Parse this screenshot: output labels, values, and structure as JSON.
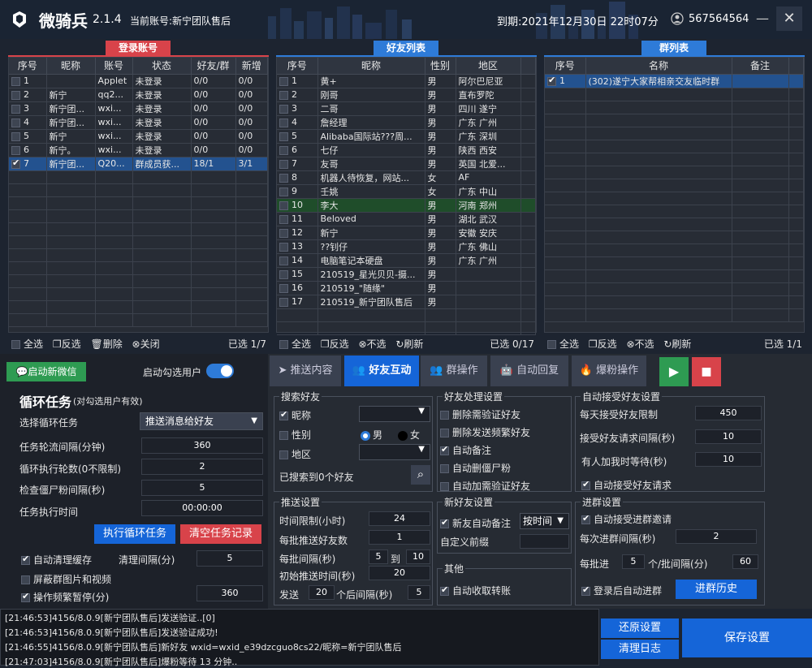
{
  "header": {
    "app_name": "微骑兵",
    "version": "2.1.4",
    "current_account": "当前账号:新宁团队售后",
    "expire": "到期:2021年12月30日 22时07分",
    "user_id": "567564564"
  },
  "accounts": {
    "title": "登录账号",
    "columns": [
      "序号",
      "昵称",
      "账号",
      "状态",
      "好友/群",
      "新增"
    ],
    "rows": [
      {
        "checked": false,
        "sel": false,
        "c": [
          "1",
          "",
          "Applet",
          "未登录",
          "0/0",
          "0/0"
        ]
      },
      {
        "checked": false,
        "sel": false,
        "c": [
          "2",
          "新宁",
          "qq2...",
          "未登录",
          "0/0",
          "0/0"
        ]
      },
      {
        "checked": false,
        "sel": false,
        "c": [
          "3",
          "新宁团...",
          "wxi...",
          "未登录",
          "0/0",
          "0/0"
        ]
      },
      {
        "checked": false,
        "sel": false,
        "c": [
          "4",
          "新宁团...",
          "wxi...",
          "未登录",
          "0/0",
          "0/0"
        ]
      },
      {
        "checked": false,
        "sel": false,
        "c": [
          "5",
          "新宁",
          "wxi...",
          "未登录",
          "0/0",
          "0/0"
        ]
      },
      {
        "checked": false,
        "sel": false,
        "c": [
          "6",
          "新宁。",
          "wxi...",
          "未登录",
          "0/0",
          "0/0"
        ]
      },
      {
        "checked": true,
        "sel": true,
        "c": [
          "7",
          "新宁团...",
          "Q20...",
          "群成员获...",
          "18/1",
          "3/1"
        ]
      }
    ],
    "footer": {
      "select_all": "全选",
      "invert": "反选",
      "delete": "删除",
      "close": "关闭",
      "selected": "已选 1/7"
    }
  },
  "friends": {
    "title": "好友列表",
    "columns": [
      "序号",
      "昵称",
      "性别",
      "地区"
    ],
    "rows": [
      {
        "sel": false,
        "c": [
          "1",
          "黄+",
          "男",
          "阿尔巴尼亚"
        ]
      },
      {
        "sel": false,
        "c": [
          "2",
          "刚哥",
          "男",
          "直布罗陀"
        ]
      },
      {
        "sel": false,
        "c": [
          "3",
          "二哥",
          "男",
          "四川 遂宁"
        ]
      },
      {
        "sel": false,
        "c": [
          "4",
          "詹经理",
          "男",
          "广东 广州"
        ]
      },
      {
        "sel": false,
        "c": [
          "5",
          "Alibaba国际站???周...",
          "男",
          "广东 深圳"
        ]
      },
      {
        "sel": false,
        "c": [
          "6",
          "七仔",
          "男",
          "陕西 西安"
        ]
      },
      {
        "sel": false,
        "c": [
          "7",
          "友哥",
          "男",
          "英国 北爱..."
        ]
      },
      {
        "sel": false,
        "c": [
          "8",
          "机器人待恢复，网站...",
          "女",
          "AF"
        ]
      },
      {
        "sel": false,
        "c": [
          "9",
          "壬姚",
          "女",
          "广东 中山"
        ]
      },
      {
        "sel": true,
        "c": [
          "10",
          "李大",
          "男",
          "河南 郑州"
        ]
      },
      {
        "sel": false,
        "c": [
          "11",
          "Beloved",
          "男",
          "湖北 武汉"
        ]
      },
      {
        "sel": false,
        "c": [
          "12",
          "新宁",
          "男",
          "安徽 安庆"
        ]
      },
      {
        "sel": false,
        "c": [
          "13",
          "??钊仔",
          "男",
          "广东 佛山"
        ]
      },
      {
        "sel": false,
        "c": [
          "14",
          "电脑笔记本硬盘",
          "男",
          "广东 广州"
        ]
      },
      {
        "sel": false,
        "c": [
          "15",
          "210519_星光贝贝-摄...",
          "男",
          ""
        ]
      },
      {
        "sel": false,
        "c": [
          "16",
          "210519_\"随缘\"",
          "男",
          ""
        ]
      },
      {
        "sel": false,
        "c": [
          "17",
          "210519_新宁团队售后",
          "男",
          ""
        ]
      }
    ],
    "footer": {
      "select_all": "全选",
      "invert": "反选",
      "none": "不选",
      "refresh": "刷新",
      "selected": "已选 0/17"
    }
  },
  "groups": {
    "title": "群列表",
    "columns": [
      "序号",
      "名称",
      "备注"
    ],
    "rows": [
      {
        "checked": true,
        "sel": true,
        "c": [
          "1",
          "(302)遂宁大家帮相亲交友临时群",
          ""
        ]
      }
    ],
    "footer": {
      "select_all": "全选",
      "invert": "反选",
      "none": "不选",
      "refresh": "刷新",
      "selected": "已选 1/1"
    }
  },
  "left": {
    "start_wechat": "启动新微信",
    "auto_select": "启动勾选用户",
    "loop_title": "循环任务",
    "loop_sub": "(对勾选用户有效)",
    "select_task_label": "选择循环任务",
    "select_task_value": "推送消息给好友",
    "interval_label": "任务轮流间隔(分钟)",
    "interval_value": "360",
    "rounds_label": "循环执行轮数(0不限制)",
    "rounds_value": "2",
    "check_label": "检查僵尸粉间隔(秒)",
    "check_value": "5",
    "time_label": "任务执行时间",
    "time_value": "00:00:00",
    "exec_btn": "执行循环任务",
    "clear_btn": "清空任务记录",
    "auto_clean": "自动清理缓存",
    "clean_interval_label": "清理间隔(分)",
    "clean_interval_value": "5",
    "block_media": "屏蔽群图片和视频",
    "freq_pause": "操作频繁暂停(分)",
    "freq_value": "360"
  },
  "tabs": [
    "推送内容",
    "好友互动",
    "群操作",
    "自动回复",
    "爆粉操作"
  ],
  "search": {
    "title": "搜索好友",
    "nickname": "昵称",
    "gender": "性别",
    "male": "男",
    "female": "女",
    "region": "地区",
    "result": "已搜索到0个好友"
  },
  "friend_proc": {
    "title": "好友处理设置",
    "items": [
      {
        "label": "删除需验证好友",
        "on": false
      },
      {
        "label": "删除发送频繁好友",
        "on": false
      },
      {
        "label": "自动备注",
        "on": true
      },
      {
        "label": "自动删僵尸粉",
        "on": false
      },
      {
        "label": "自动加需验证好友",
        "on": false
      }
    ]
  },
  "auto_accept": {
    "title": "自动接受好友设置",
    "daily_label": "每天接受好友限制",
    "daily_value": "450",
    "interval_label": "接受好友请求间隔(秒)",
    "interval_value": "10",
    "wait_label": "有人加我时等待(秒)",
    "wait_value": "10",
    "auto_accept_label": "自动接受好友请求"
  },
  "push": {
    "title": "推送设置",
    "time_limit_label": "时间限制(小时)",
    "time_limit_value": "24",
    "batch_label": "每批推送好友数",
    "batch_value": "1",
    "batch_interval_label": "每批间隔(秒)",
    "batch_from": "5",
    "to": "到",
    "batch_to": "10",
    "init_label": "初始推送时间(秒)",
    "init_value": "20",
    "send_label": "发送",
    "send_value": "20",
    "after_label": "个后间隔(秒)",
    "after_value": "5"
  },
  "new_friend": {
    "title": "新好友设置",
    "auto_remark": "新友自动备注",
    "remark_mode": "按时间",
    "prefix_label": "自定义前缀"
  },
  "other": {
    "title": "其他",
    "auto_receive": "自动收取转账"
  },
  "join_group": {
    "title": "进群设置",
    "auto_accept": "自动接受进群邀请",
    "interval_label": "每次进群间隔(秒)",
    "interval_value": "2",
    "batch_label": "每批进",
    "batch_value": "5",
    "batch_suffix": "个/批间隔(分)",
    "batch_interval": "60",
    "auto_join": "登录后自动进群",
    "history_btn": "进群历史"
  },
  "logs": [
    "[21:46:53]4156/8.0.9[新宁团队售后]发送验证..[0]",
    "[21:46:53]4156/8.0.9[新宁团队售后]发送验证成功!",
    "[21:46:55]4156/8.0.9[新宁团队售后]新好友 wxid=wxid_e39dzcguo8cs22/昵称=新宁团队售后",
    "[21:47:03]4156/8.0.9[新宁团队售后]爆粉等待 13 分钟.."
  ],
  "bottom": {
    "restore": "还原设置",
    "clear_log": "清理日志",
    "save": "保存设置"
  },
  "colors": {
    "red": "#d8434a",
    "blue": "#2e7bd8",
    "green": "#2e9b52",
    "accent": "#1565d8"
  }
}
